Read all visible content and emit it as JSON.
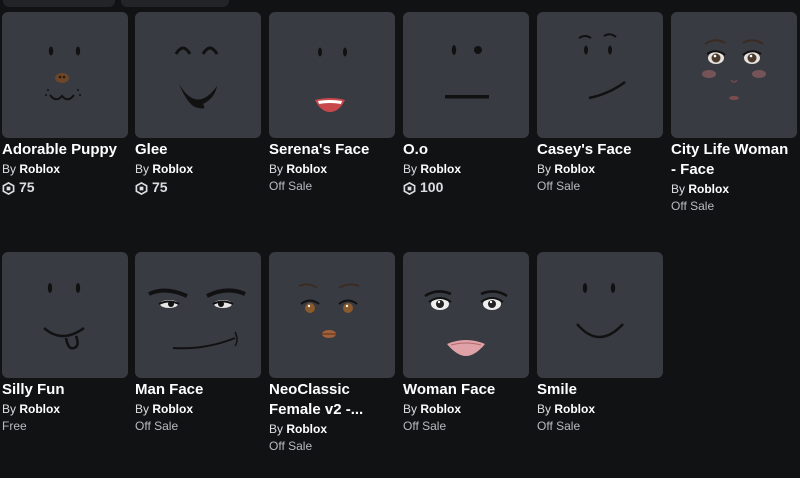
{
  "currency_icon": "robux-icon",
  "creator_prefix": "By",
  "items": [
    {
      "name": "Adorable Puppy",
      "creator": "Roblox",
      "price": "75",
      "status": ""
    },
    {
      "name": "Glee",
      "creator": "Roblox",
      "price": "75",
      "status": ""
    },
    {
      "name": "Serena's Face",
      "creator": "Roblox",
      "price": "",
      "status": "Off Sale"
    },
    {
      "name": "O.o",
      "creator": "Roblox",
      "price": "100",
      "status": ""
    },
    {
      "name": "Casey's Face",
      "creator": "Roblox",
      "price": "",
      "status": "Off Sale"
    },
    {
      "name": "City Life Woman - Face",
      "creator": "Roblox",
      "price": "",
      "status": "Off Sale"
    },
    {
      "name": "Silly Fun",
      "creator": "Roblox",
      "price": "",
      "status": "Free"
    },
    {
      "name": "Man Face",
      "creator": "Roblox",
      "price": "",
      "status": "Off Sale"
    },
    {
      "name": "NeoClassic Female v2 -...",
      "creator": "Roblox",
      "price": "",
      "status": "Off Sale"
    },
    {
      "name": "Woman Face",
      "creator": "Roblox",
      "price": "",
      "status": "Off Sale"
    },
    {
      "name": "Smile",
      "creator": "Roblox",
      "price": "",
      "status": "Off Sale"
    }
  ]
}
